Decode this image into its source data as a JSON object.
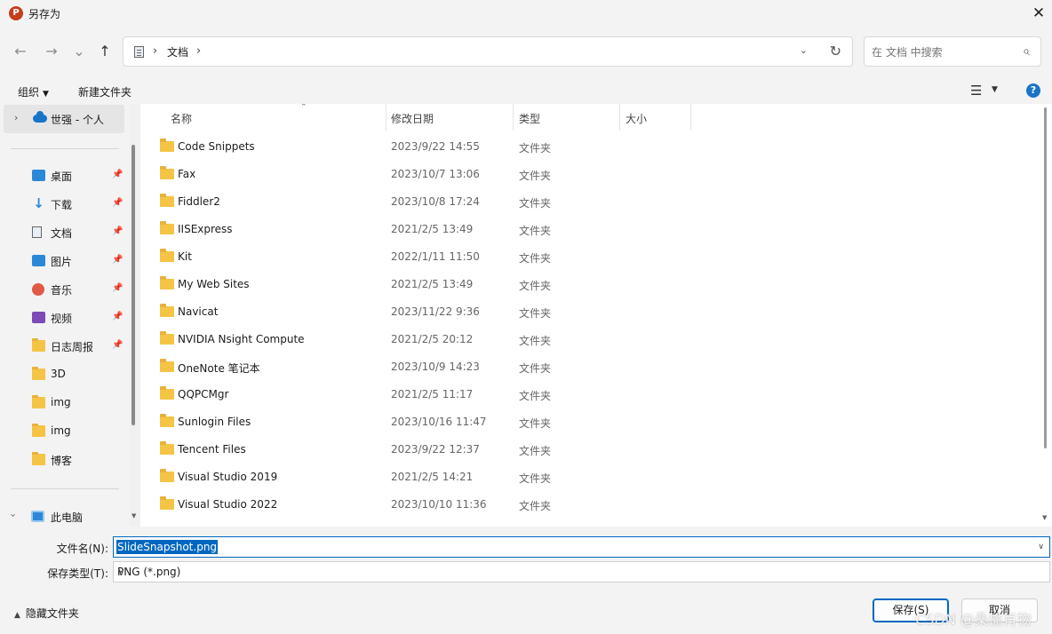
{
  "window": {
    "title": "另存为",
    "app_icon": "P"
  },
  "nav": {
    "back": "←",
    "forward": "→",
    "recent": "⌄",
    "up": "↑"
  },
  "address": {
    "crumb": "文档",
    "sep": "›",
    "dropdown": "⌄",
    "refresh": "↻"
  },
  "search": {
    "placeholder": "在 文档 中搜索"
  },
  "commands": {
    "organize": "组织",
    "new_folder": "新建文件夹",
    "help": "?"
  },
  "sidebar": {
    "onedrive": "世强 - 个人",
    "items": [
      {
        "label": "桌面",
        "icon": "desktop-icon",
        "pinned": true
      },
      {
        "label": "下载",
        "icon": "download-icon",
        "pinned": true
      },
      {
        "label": "文档",
        "icon": "documents-icon",
        "pinned": true
      },
      {
        "label": "图片",
        "icon": "pictures-icon",
        "pinned": true
      },
      {
        "label": "音乐",
        "icon": "music-icon",
        "pinned": true
      },
      {
        "label": "视频",
        "icon": "videos-icon",
        "pinned": true
      },
      {
        "label": "日志周报",
        "icon": "folder-icon",
        "pinned": true
      },
      {
        "label": "3D",
        "icon": "folder-icon",
        "pinned": false
      },
      {
        "label": "img",
        "icon": "folder-icon",
        "pinned": false
      },
      {
        "label": "img",
        "icon": "folder-icon",
        "pinned": false
      },
      {
        "label": "博客",
        "icon": "folder-icon",
        "pinned": false
      }
    ],
    "this_pc": "此电脑"
  },
  "columns": {
    "name": "名称",
    "modified": "修改日期",
    "type": "类型",
    "size": "大小"
  },
  "files": [
    {
      "name": "Code Snippets",
      "date": "2023/9/22 14:55",
      "type": "文件夹"
    },
    {
      "name": "Fax",
      "date": "2023/10/7 13:06",
      "type": "文件夹"
    },
    {
      "name": "Fiddler2",
      "date": "2023/10/8 17:24",
      "type": "文件夹"
    },
    {
      "name": "IISExpress",
      "date": "2021/2/5 13:49",
      "type": "文件夹"
    },
    {
      "name": "Kit",
      "date": "2022/1/11 11:50",
      "type": "文件夹"
    },
    {
      "name": "My Web Sites",
      "date": "2021/2/5 13:49",
      "type": "文件夹"
    },
    {
      "name": "Navicat",
      "date": "2023/11/22 9:36",
      "type": "文件夹"
    },
    {
      "name": "NVIDIA Nsight Compute",
      "date": "2021/2/5 20:12",
      "type": "文件夹"
    },
    {
      "name": "OneNote 笔记本",
      "date": "2023/10/9 14:23",
      "type": "文件夹"
    },
    {
      "name": "QQPCMgr",
      "date": "2021/2/5 11:17",
      "type": "文件夹"
    },
    {
      "name": "Sunlogin Files",
      "date": "2023/10/16 11:47",
      "type": "文件夹"
    },
    {
      "name": "Tencent Files",
      "date": "2023/9/22 12:37",
      "type": "文件夹"
    },
    {
      "name": "Visual Studio 2019",
      "date": "2021/2/5 14:21",
      "type": "文件夹"
    },
    {
      "name": "Visual Studio 2022",
      "date": "2023/10/10 11:36",
      "type": "文件夹"
    }
  ],
  "save": {
    "filename_label": "文件名(N):",
    "filename_value": "SlideSnapshot.png",
    "filetype_label": "保存类型(T):",
    "filetype_value": "PNG (*.png)",
    "hide_folders": "隐藏文件夹",
    "save_button": "保存(S)",
    "cancel_button": "取消"
  },
  "watermark": "CSDN @桑榆肖物",
  "colors": {
    "accent": "#0067c0",
    "folder": "#f5c445",
    "selection": "#e5e5e5"
  }
}
